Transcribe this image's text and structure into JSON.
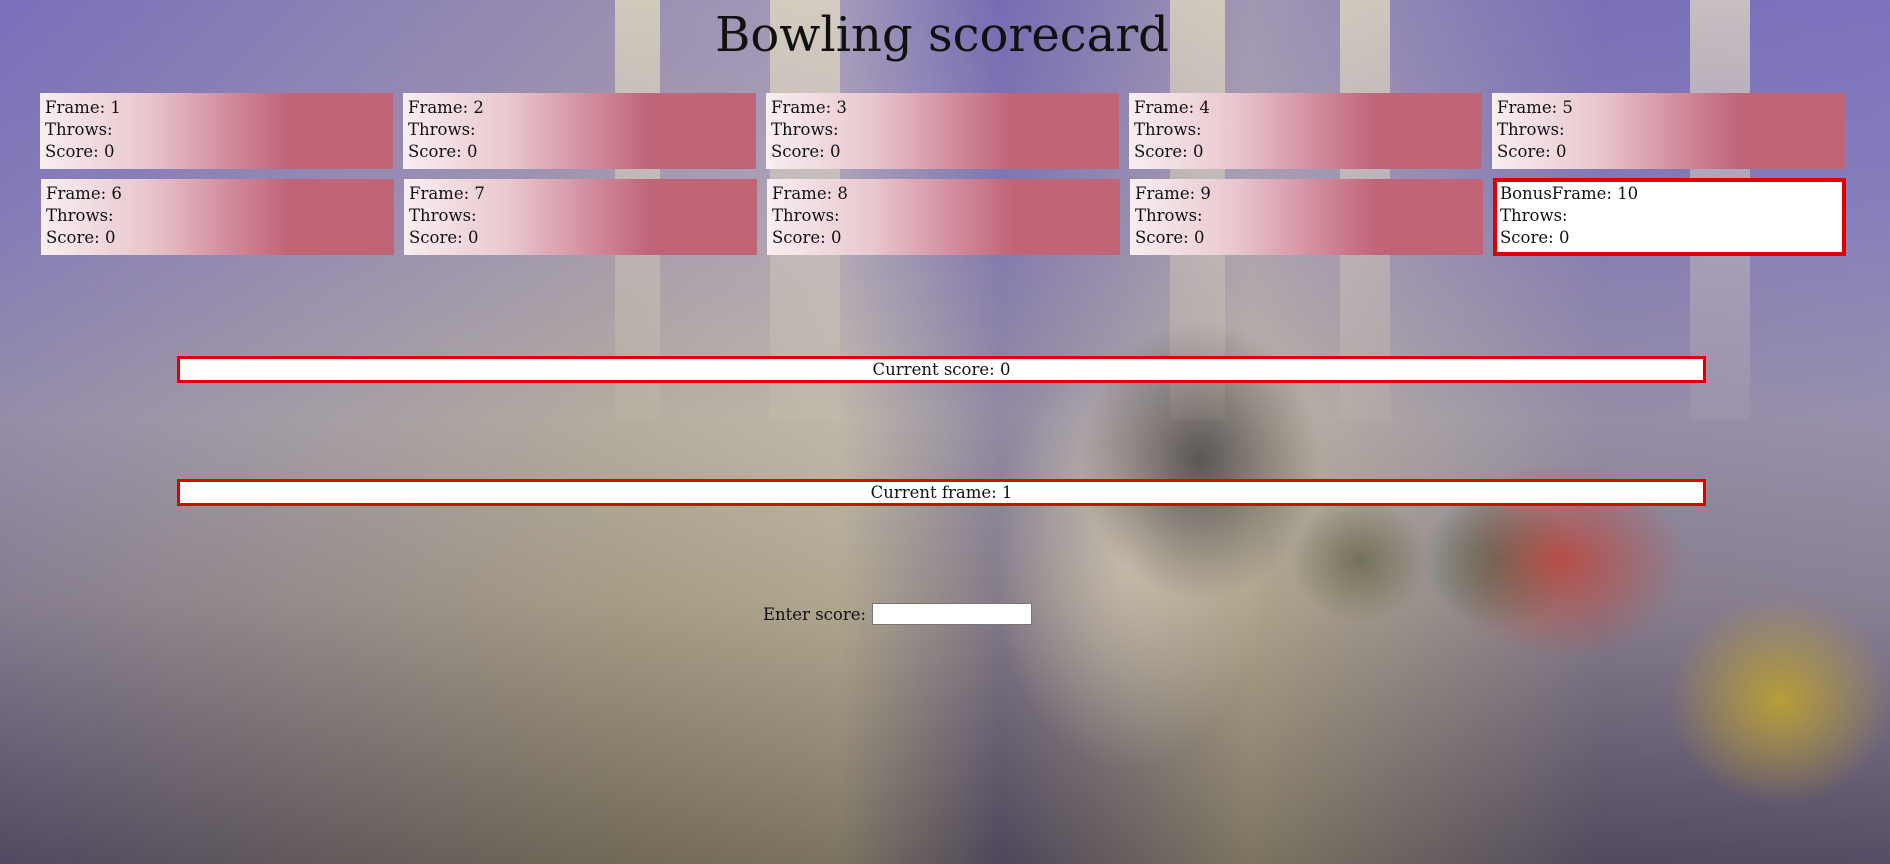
{
  "page": {
    "title": "Bowling scorecard"
  },
  "labels": {
    "frame": "Frame:",
    "bonus_frame": "BonusFrame:",
    "throws": "Throws:",
    "score": "Score:"
  },
  "frames": [
    {
      "number": "1",
      "throws": "",
      "score": "0"
    },
    {
      "number": "2",
      "throws": "",
      "score": "0"
    },
    {
      "number": "3",
      "throws": "",
      "score": "0"
    },
    {
      "number": "4",
      "throws": "",
      "score": "0"
    },
    {
      "number": "5",
      "throws": "",
      "score": "0"
    },
    {
      "number": "6",
      "throws": "",
      "score": "0"
    },
    {
      "number": "7",
      "throws": "",
      "score": "0"
    },
    {
      "number": "8",
      "throws": "",
      "score": "0"
    },
    {
      "number": "9",
      "throws": "",
      "score": "0"
    },
    {
      "number": "10",
      "throws": "",
      "score": "0"
    }
  ],
  "status": {
    "current_score": "Current score: 0",
    "current_frame": "Current frame: 1"
  },
  "entry": {
    "label": "Enter score:",
    "value": ""
  },
  "colors": {
    "highlight_border": "#e00000",
    "frame_fill": "#c06478"
  }
}
